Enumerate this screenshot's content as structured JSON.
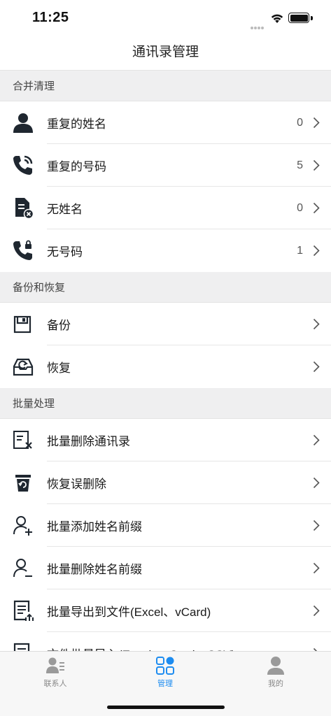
{
  "status_bar": {
    "time": "11:25"
  },
  "nav": {
    "title": "通讯录管理"
  },
  "sections": [
    {
      "title": "合并清理",
      "rows": [
        {
          "label": "重复的姓名",
          "count": "0",
          "icon": "contact-person-icon"
        },
        {
          "label": "重复的号码",
          "count": "5",
          "icon": "phone-call-icon"
        },
        {
          "label": "无姓名",
          "count": "0",
          "icon": "document-x-icon"
        },
        {
          "label": "无号码",
          "count": "1",
          "icon": "phone-lock-icon"
        }
      ]
    },
    {
      "title": "备份和恢复",
      "rows": [
        {
          "label": "备份",
          "icon": "backup-box-icon"
        },
        {
          "label": "恢复",
          "icon": "restore-tray-icon"
        }
      ]
    },
    {
      "title": "批量处理",
      "rows": [
        {
          "label": "批量删除通讯录",
          "icon": "list-delete-icon"
        },
        {
          "label": "恢复误删除",
          "icon": "trash-restore-icon"
        },
        {
          "label": "批量添加姓名前缀",
          "icon": "user-add-icon"
        },
        {
          "label": "批量删除姓名前缀",
          "icon": "user-remove-icon"
        },
        {
          "label": "批量导出到文件(Excel、vCard)",
          "icon": "file-export-icon"
        },
        {
          "label": "文件批量导入(Excel、vCard、CSV)",
          "icon": "file-import-icon"
        }
      ]
    }
  ],
  "tab_bar": {
    "tabs": [
      {
        "label": "联系人",
        "icon": "contacts-icon",
        "active": false
      },
      {
        "label": "管理",
        "icon": "manage-grid-icon",
        "active": true
      },
      {
        "label": "我的",
        "icon": "profile-icon",
        "active": false
      }
    ]
  },
  "colors": {
    "accent": "#1d8cf0",
    "section_bg": "#efeff0",
    "row_bg": "#ffffff",
    "tab_inactive": "#888888"
  }
}
